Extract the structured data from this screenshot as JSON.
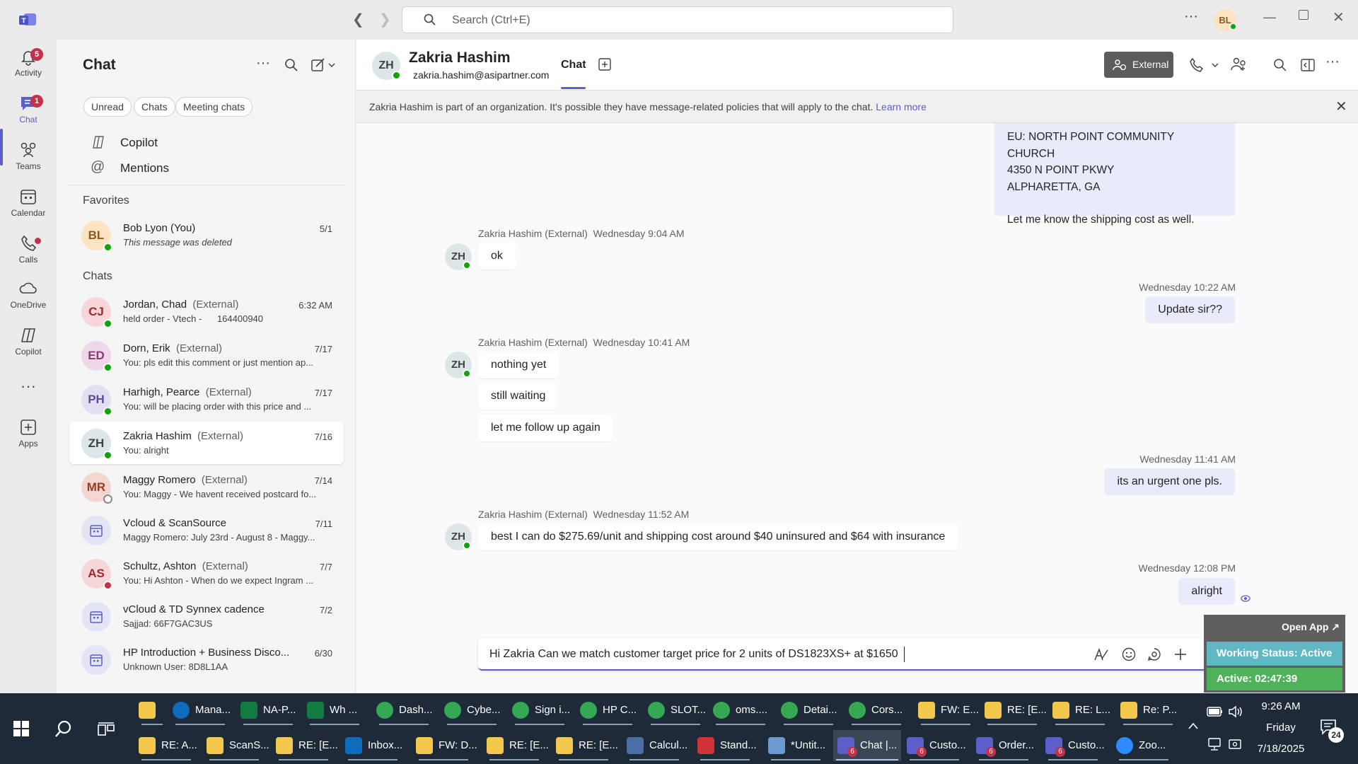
{
  "titlebar": {
    "search_placeholder": "Search (Ctrl+E)",
    "user_initials": "BL"
  },
  "rail": {
    "items": [
      {
        "label": "Activity",
        "badge": "5"
      },
      {
        "label": "Chat",
        "badge": "1"
      },
      {
        "label": "Teams"
      },
      {
        "label": "Calendar"
      },
      {
        "label": "Calls"
      },
      {
        "label": "OneDrive"
      },
      {
        "label": "Copilot"
      },
      {
        "label": "Apps"
      }
    ]
  },
  "left_panel": {
    "title": "Chat",
    "filters": [
      "Unread",
      "Chats",
      "Meeting chats"
    ],
    "nav": [
      "Copilot",
      "Mentions"
    ],
    "favorites_heading": "Favorites",
    "favorites": [
      {
        "initials": "BL",
        "name": "Bob Lyon (You)",
        "ext": "",
        "preview": "This message was deleted",
        "date": "5/1"
      }
    ],
    "chats_heading": "Chats",
    "chats": [
      {
        "initials": "CJ",
        "name": "Jordan, Chad",
        "ext": "(External)",
        "preview": "held order - Vtech -      164400940",
        "date": "6:32 AM"
      },
      {
        "initials": "ED",
        "name": "Dorn, Erik",
        "ext": "(External)",
        "preview": "You: pls edit this comment or just mention ap...",
        "date": "7/17"
      },
      {
        "initials": "PH",
        "name": "Harhigh, Pearce",
        "ext": "(External)",
        "preview": "You: will be placing order with this price and ...",
        "date": "7/17"
      },
      {
        "initials": "ZH",
        "name": "Zakria Hashim",
        "ext": "(External)",
        "preview": "You: alright",
        "date": "7/16"
      },
      {
        "initials": "MR",
        "name": "Maggy Romero",
        "ext": "(External)",
        "preview": "You: Maggy - We havent received postcard fo...",
        "date": "7/14"
      },
      {
        "initials": "",
        "name": "Vcloud & ScanSource",
        "ext": "",
        "preview": "Maggy Romero: July 23rd - August 8 - Maggy...",
        "date": "7/11"
      },
      {
        "initials": "AS",
        "name": "Schultz, Ashton",
        "ext": "(External)",
        "preview": "You: Hi Ashton -  When do we expect Ingram ...",
        "date": "7/7"
      },
      {
        "initials": "",
        "name": "vCloud & TD Synnex cadence",
        "ext": "",
        "preview": "Sajjad: 66F7GAC3US",
        "date": "7/2"
      },
      {
        "initials": "",
        "name": "HP Introduction + Business Disco...",
        "ext": "",
        "preview": "Unknown User: 8D8L1AA",
        "date": "6/30"
      }
    ]
  },
  "chat_header": {
    "initials": "ZH",
    "name": "Zakria Hashim",
    "email": "zakria.hashim@asipartner.com",
    "tab": "Chat",
    "external_label": "External"
  },
  "banner": {
    "text": "Zakria Hashim is part of an organization. It's possible they have message-related policies that will apply to the chat.",
    "link": "Learn more"
  },
  "messages": {
    "top_out": [
      "EU: NORTH POINT COMMUNITY CHURCH",
      "4350 N POINT PKWY",
      "ALPHARETTA, GA",
      "Let me know the shipping cost as well."
    ],
    "g1_meta": "Zakria Hashim (External)",
    "g1_time": "Wednesday 9:04 AM",
    "g1_msgs": [
      "ok"
    ],
    "o1_time": "Wednesday 10:22 AM",
    "o1_msg": "Update sir??",
    "g2_meta": "Zakria Hashim (External)",
    "g2_time": "Wednesday 10:41 AM",
    "g2_msgs": [
      "nothing yet",
      "still waiting",
      "let me follow up again"
    ],
    "o2_time": "Wednesday 11:41 AM",
    "o2_msg": "its an urgent one pls.",
    "g3_meta": "Zakria Hashim (External)",
    "g3_time": "Wednesday 11:52 AM",
    "g3_msgs": [
      "best I can do $275.69/unit and shipping cost around $40 uninsured and $64 with insurance"
    ],
    "o3_time": "Wednesday 12:08 PM",
    "o3_msg": "alright"
  },
  "compose": {
    "text": "Hi Zakria Can we match customer target price for 2 units of DS1823XS+ at $1650"
  },
  "zoom_widget": {
    "open_app": "Open App ↗",
    "working_status": "Working Status: Active",
    "active_timer": "Active: 02:47:39"
  },
  "taskbar": {
    "row1": [
      {
        "label": "",
        "color": "#f2c94c"
      },
      {
        "label": "Mana...",
        "color": "#0f6cbd"
      },
      {
        "label": "NA-P...",
        "color": "#107c41"
      },
      {
        "label": "Wh ...",
        "color": "#107c41"
      },
      {
        "label": "Dash...",
        "color": "#34a853"
      },
      {
        "label": "Cybe...",
        "color": "#34a853"
      },
      {
        "label": "Sign i...",
        "color": "#34a853"
      },
      {
        "label": "HP C...",
        "color": "#34a853"
      },
      {
        "label": "SLOT...",
        "color": "#34a853"
      },
      {
        "label": "oms....",
        "color": "#34a853"
      },
      {
        "label": "Detai...",
        "color": "#34a853"
      },
      {
        "label": "Cors...",
        "color": "#34a853"
      },
      {
        "label": "FW: E...",
        "color": "#f2c94c"
      },
      {
        "label": "RE: [E...",
        "color": "#f2c94c"
      },
      {
        "label": "RE: L...",
        "color": "#f2c94c"
      },
      {
        "label": "Re: P...",
        "color": "#f2c94c"
      }
    ],
    "row2": [
      {
        "label": "RE: A...",
        "color": "#f2c94c"
      },
      {
        "label": "ScanS...",
        "color": "#f2c94c"
      },
      {
        "label": "RE: [E...",
        "color": "#f2c94c"
      },
      {
        "label": "Inbox...",
        "color": "#0f6cbd"
      },
      {
        "label": "FW: D...",
        "color": "#f2c94c"
      },
      {
        "label": "RE: [E...",
        "color": "#f2c94c"
      },
      {
        "label": "RE: [E...",
        "color": "#f2c94c"
      },
      {
        "label": "Calcul...",
        "color": "#4a6fa5"
      },
      {
        "label": "Stand...",
        "color": "#d13438"
      },
      {
        "label": "*Untit...",
        "color": "#6c9bd2"
      },
      {
        "label": "Chat |...",
        "color": "#5b5fc7",
        "badge": "6"
      },
      {
        "label": "Custo...",
        "color": "#5b5fc7",
        "badge": "6"
      },
      {
        "label": "Order...",
        "color": "#5b5fc7",
        "badge": "6"
      },
      {
        "label": "Custo...",
        "color": "#5b5fc7",
        "badge": "6"
      },
      {
        "label": "Zoo...",
        "color": "#2d8cff"
      }
    ],
    "time": "9:26 AM",
    "day": "Friday",
    "date": "7/18/2025",
    "notification_count": "24"
  },
  "colors": {
    "accent": "#5b5fc7",
    "presence_available": "#13a10e",
    "zoom_green": "#4fb25a",
    "zoom_teal": "#5fb8c4"
  }
}
